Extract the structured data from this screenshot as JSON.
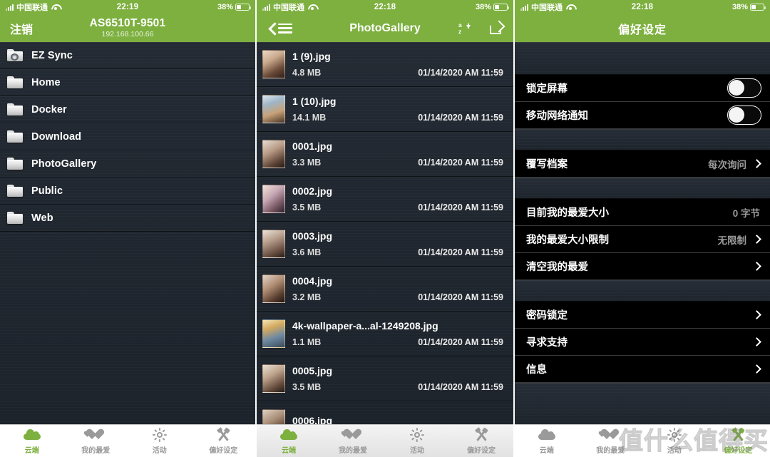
{
  "panel1": {
    "statusbar": {
      "carrier": "中国联通",
      "time": "22:19",
      "battery": "38%"
    },
    "nav": {
      "logout": "注销",
      "device": "AS6510T-9501",
      "ip": "192.168.100.66"
    },
    "folders": [
      {
        "name": "EZ Sync",
        "icon": "folder-sync-icon"
      },
      {
        "name": "Home",
        "icon": "folder-icon"
      },
      {
        "name": "Docker",
        "icon": "folder-icon"
      },
      {
        "name": "Download",
        "icon": "folder-icon"
      },
      {
        "name": "PhotoGallery",
        "icon": "folder-icon"
      },
      {
        "name": "Public",
        "icon": "folder-icon"
      },
      {
        "name": "Web",
        "icon": "folder-icon"
      }
    ]
  },
  "panel2": {
    "statusbar": {
      "carrier": "中国联通",
      "time": "22:18",
      "battery": "38%"
    },
    "nav": {
      "title": "PhotoGallery",
      "back": "back-icon",
      "menu": "menu-icon",
      "sort": "sort-az-icon",
      "edit": "edit-icon"
    },
    "files": [
      {
        "name": "1 (9).jpg",
        "size": "4.8 MB",
        "date": "01/14/2020 AM 11:59"
      },
      {
        "name": "1 (10).jpg",
        "size": "14.1 MB",
        "date": "01/14/2020 AM 11:59"
      },
      {
        "name": "0001.jpg",
        "size": "3.3 MB",
        "date": "01/14/2020 AM 11:59"
      },
      {
        "name": "0002.jpg",
        "size": "3.5 MB",
        "date": "01/14/2020 AM 11:59"
      },
      {
        "name": "0003.jpg",
        "size": "3.6 MB",
        "date": "01/14/2020 AM 11:59"
      },
      {
        "name": "0004.jpg",
        "size": "3.2 MB",
        "date": "01/14/2020 AM 11:59"
      },
      {
        "name": "4k-wallpaper-a...al-1249208.jpg",
        "size": "1.1 MB",
        "date": "01/14/2020 AM 11:59"
      },
      {
        "name": "0005.jpg",
        "size": "3.5 MB",
        "date": "01/14/2020 AM 11:59"
      },
      {
        "name": "0006.jpg",
        "size": "",
        "date": ""
      }
    ]
  },
  "panel3": {
    "statusbar": {
      "carrier": "中国联通",
      "time": "22:18",
      "battery": "38%"
    },
    "nav": {
      "title": "偏好设定"
    },
    "group1": [
      {
        "label": "锁定屏幕",
        "type": "toggle",
        "value": "off"
      },
      {
        "label": "移动网络通知",
        "type": "toggle",
        "value": "off"
      }
    ],
    "group2": [
      {
        "label": "覆写档案",
        "type": "chevron",
        "value": "每次询问"
      }
    ],
    "group3": [
      {
        "label": "目前我的最爱大小",
        "type": "value",
        "value": "0 字节"
      },
      {
        "label": "我的最爱大小限制",
        "type": "chevron",
        "value": "无限制"
      },
      {
        "label": "清空我的最爱",
        "type": "chevron",
        "value": ""
      }
    ],
    "group4": [
      {
        "label": "密码锁定",
        "type": "chevron",
        "value": ""
      },
      {
        "label": "寻求支持",
        "type": "chevron",
        "value": ""
      },
      {
        "label": "信息",
        "type": "chevron",
        "value": ""
      }
    ],
    "watermark": "值什么值得买"
  },
  "tabbar": {
    "items": [
      {
        "label": "云端",
        "icon": "cloud-icon"
      },
      {
        "label": "我的最爱",
        "icon": "hearts-icon"
      },
      {
        "label": "活动",
        "icon": "sun-icon"
      },
      {
        "label": "偏好设定",
        "icon": "tools-icon"
      }
    ],
    "active_panel1": 0,
    "active_panel2": 0,
    "active_panel3": 3
  },
  "colors": {
    "accent_green": "#7db03f",
    "list_dark": "#232a33",
    "row_black": "#000000"
  }
}
